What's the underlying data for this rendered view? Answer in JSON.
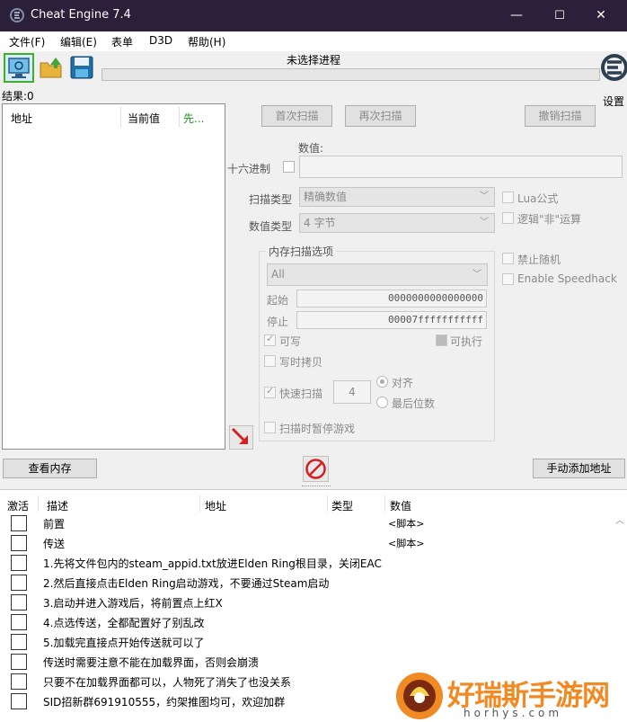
{
  "window": {
    "title": "Cheat Engine 7.4",
    "min": "—",
    "max": "☐",
    "close": "✕"
  },
  "menu": [
    "文件(F)",
    "编辑(E)",
    "表单",
    "D3D",
    "帮助(H)"
  ],
  "toolbar": {
    "process_label": "未选择进程",
    "settings_label": "设置",
    "icons": [
      "monitor-icon",
      "folder-open-icon",
      "save-disk-icon"
    ]
  },
  "results": {
    "count_label": "结果:0",
    "headers": [
      "地址",
      "当前值",
      "先..."
    ]
  },
  "scan": {
    "first_scan": "首次扫描",
    "next_scan": "再次扫描",
    "undo_scan": "撤销扫描",
    "value_label": "数值:",
    "hex_label": "十六进制",
    "scan_type_label": "扫描类型",
    "scan_type_value": "精确数值",
    "value_type_label": "数值类型",
    "value_type_value": "4 字节",
    "lua_formula": "Lua公式",
    "logic_not": "逻辑\"非\"运算",
    "disable_random": "禁止随机",
    "enable_speedhack": "Enable Speedhack"
  },
  "memory": {
    "group_title": "内存扫描选项",
    "region": "All",
    "start_label": "起始",
    "start_value": "0000000000000000",
    "stop_label": "停止",
    "stop_value": "00007fffffffffff",
    "writable": "可写",
    "executable": "可执行",
    "copy_on_write": "写时拷贝",
    "fast_scan": "快速扫描",
    "fast_scan_value": "4",
    "align": "对齐",
    "last_digits": "最后位数",
    "pause_game": "扫描时暂停游戏"
  },
  "bottom": {
    "view_memory": "查看内存",
    "add_address": "手动添加地址"
  },
  "table": {
    "headers": [
      "激活",
      "描述",
      "地址",
      "类型",
      "数值"
    ],
    "rows": [
      {
        "desc": "前置",
        "value": "<脚本>"
      },
      {
        "desc": "传送",
        "value": "<脚本>"
      },
      {
        "desc": "1.先将文件包内的steam_appid.txt放进Elden Ring根目录，关闭EAC",
        "value": ""
      },
      {
        "desc": "2.然后直接点击Elden Ring启动游戏，不要通过Steam启动",
        "value": ""
      },
      {
        "desc": "3.启动并进入游戏后，将前置点上红X",
        "value": ""
      },
      {
        "desc": "4.点选传送，全都配置好了别乱改",
        "value": ""
      },
      {
        "desc": "5.加载完直接点开始传送就可以了",
        "value": ""
      },
      {
        "desc": "传送时需要注意不能在加载界面，否则会崩溃",
        "value": ""
      },
      {
        "desc": "只要不在加载界面都可以，人物死了消失了也没关系",
        "value": ""
      },
      {
        "desc": "SID招新群691910555，约架推图均可，欢迎加群",
        "value": ""
      }
    ]
  },
  "watermark": {
    "name": "好瑞斯手游网",
    "url": "horhys.com"
  },
  "colors": {
    "titlebar": "#2b1f3a",
    "accent_green": "#4caf2f",
    "watermark_orange": "#f08a24"
  }
}
